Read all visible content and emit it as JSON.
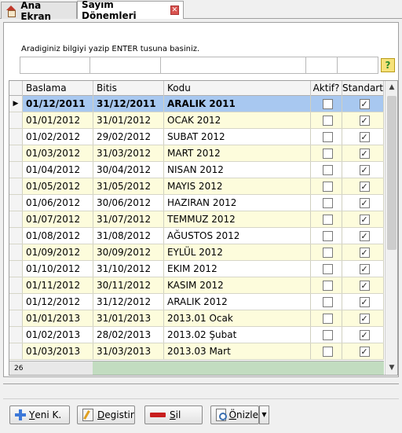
{
  "tabs": [
    {
      "label": "Ana Ekran"
    },
    {
      "label": "Sayım Dönemleri"
    }
  ],
  "search": {
    "hint": "Aradiginiz bilgiyi yazip ENTER tusuna basiniz."
  },
  "grid": {
    "headers": {
      "baslama": "Baslama",
      "bitis": "Bitis",
      "kodu": "Kodu",
      "aktif": "Aktif?",
      "standart": "Standart"
    },
    "rows": [
      {
        "baslama": "01/12/2011",
        "bitis": "31/12/2011",
        "kodu": "ARALIK 2011",
        "aktif": false,
        "standart": true,
        "selected": true
      },
      {
        "baslama": "01/01/2012",
        "bitis": "31/01/2012",
        "kodu": "OCAK 2012",
        "aktif": false,
        "standart": true
      },
      {
        "baslama": "01/02/2012",
        "bitis": "29/02/2012",
        "kodu": "SUBAT 2012",
        "aktif": false,
        "standart": true
      },
      {
        "baslama": "01/03/2012",
        "bitis": "31/03/2012",
        "kodu": "MART 2012",
        "aktif": false,
        "standart": true
      },
      {
        "baslama": "01/04/2012",
        "bitis": "30/04/2012",
        "kodu": "NISAN 2012",
        "aktif": false,
        "standart": true
      },
      {
        "baslama": "01/05/2012",
        "bitis": "31/05/2012",
        "kodu": "MAYIS 2012",
        "aktif": false,
        "standart": true
      },
      {
        "baslama": "01/06/2012",
        "bitis": "30/06/2012",
        "kodu": "HAZIRAN 2012",
        "aktif": false,
        "standart": true
      },
      {
        "baslama": "01/07/2012",
        "bitis": "31/07/2012",
        "kodu": "TEMMUZ 2012",
        "aktif": false,
        "standart": true
      },
      {
        "baslama": "01/08/2012",
        "bitis": "31/08/2012",
        "kodu": "AĞUSTOS 2012",
        "aktif": false,
        "standart": true
      },
      {
        "baslama": "01/09/2012",
        "bitis": "30/09/2012",
        "kodu": "EYLÜL 2012",
        "aktif": false,
        "standart": true
      },
      {
        "baslama": "01/10/2012",
        "bitis": "31/10/2012",
        "kodu": "EKIM 2012",
        "aktif": false,
        "standart": true
      },
      {
        "baslama": "01/11/2012",
        "bitis": "30/11/2012",
        "kodu": "KASIM 2012",
        "aktif": false,
        "standart": true
      },
      {
        "baslama": "01/12/2012",
        "bitis": "31/12/2012",
        "kodu": "ARALIK 2012",
        "aktif": false,
        "standart": true
      },
      {
        "baslama": "01/01/2013",
        "bitis": "31/01/2013",
        "kodu": "2013.01 Ocak",
        "aktif": false,
        "standart": true
      },
      {
        "baslama": "01/02/2013",
        "bitis": "28/02/2013",
        "kodu": "2013.02 Şubat",
        "aktif": false,
        "standart": true
      },
      {
        "baslama": "01/03/2013",
        "bitis": "31/03/2013",
        "kodu": "2013.03 Mart",
        "aktif": false,
        "standart": true
      }
    ],
    "record_count": "26"
  },
  "buttons": {
    "yeni": {
      "hot": "Y",
      "rest": "eni K."
    },
    "degistir": {
      "hot": "D",
      "rest": "egistir"
    },
    "sil": {
      "hot": "S",
      "rest": "il"
    },
    "onizle": {
      "hot": "Ö",
      "rest": "nizle"
    }
  },
  "colors": {
    "selected_row": "#a8c8f0",
    "alt_row": "#fdfcdc",
    "footer_green": "#c2dcc0"
  }
}
